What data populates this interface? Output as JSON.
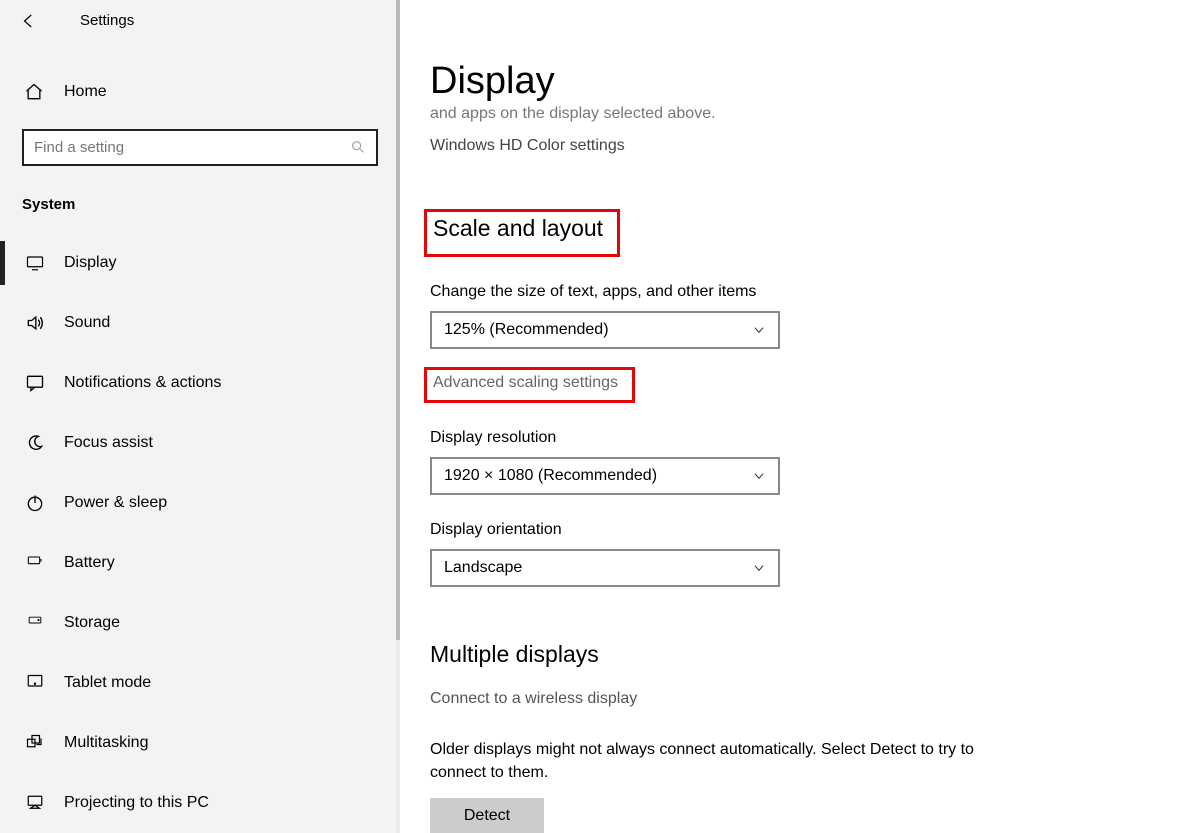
{
  "header": {
    "title": "Settings"
  },
  "sidebar": {
    "home": "Home",
    "search_placeholder": "Find a setting",
    "category": "System",
    "items": [
      {
        "label": "Display",
        "icon": "monitor-icon",
        "active": true
      },
      {
        "label": "Sound",
        "icon": "speaker-icon"
      },
      {
        "label": "Notifications & actions",
        "icon": "message-icon"
      },
      {
        "label": "Focus assist",
        "icon": "moon-icon"
      },
      {
        "label": "Power & sleep",
        "icon": "power-icon"
      },
      {
        "label": "Battery",
        "icon": "battery-icon"
      },
      {
        "label": "Storage",
        "icon": "storage-icon"
      },
      {
        "label": "Tablet mode",
        "icon": "tablet-icon"
      },
      {
        "label": "Multitasking",
        "icon": "multitask-icon"
      },
      {
        "label": "Projecting to this PC",
        "icon": "project-icon"
      }
    ]
  },
  "main": {
    "page_title": "Display",
    "truncated_line": "and apps on the display selected above.",
    "hdcolor_link": "Windows HD Color settings",
    "scale_section": {
      "heading": "Scale and layout",
      "change_size_label": "Change the size of text, apps, and other items",
      "scale_value": "125% (Recommended)",
      "advanced_link": "Advanced scaling settings",
      "resolution_label": "Display resolution",
      "resolution_value": "1920 × 1080 (Recommended)",
      "orientation_label": "Display orientation",
      "orientation_value": "Landscape"
    },
    "multiple_section": {
      "heading": "Multiple displays",
      "connect_link": "Connect to a wireless display",
      "detect_text": "Older displays might not always connect automatically. Select Detect to try to connect to them.",
      "detect_button": "Detect"
    }
  }
}
